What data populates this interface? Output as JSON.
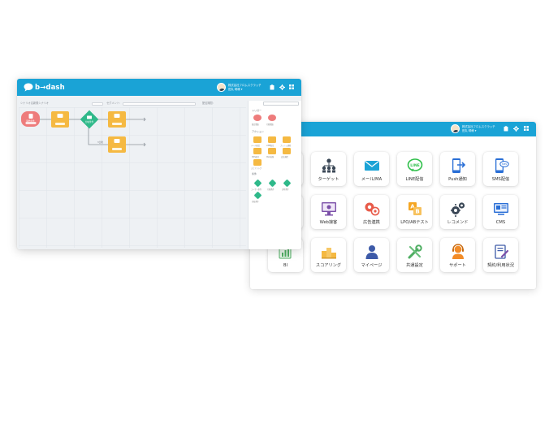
{
  "brand": {
    "logo_text": "b→dash",
    "header_color": "#1aa3d6"
  },
  "back_window": {
    "header": {
      "company": "株式会社フロムスクラッチ",
      "user": "田丸 晴様 ▾",
      "icons": [
        "clipboard-icon",
        "gear-icon",
        "grid-icon"
      ]
    },
    "tiles": [
      {
        "label": "",
        "icon": "partial-tile"
      },
      {
        "label": "ターゲット",
        "icon": "hierarchy-icon"
      },
      {
        "label": "メール/MA",
        "icon": "mail-icon"
      },
      {
        "label": "LINE配信",
        "icon": "line-icon"
      },
      {
        "label": "Push通知",
        "icon": "push-icon"
      },
      {
        "label": "SMS配信",
        "icon": "sms-icon"
      },
      {
        "label": "",
        "icon": "partial-tile"
      },
      {
        "label": "Web接客",
        "icon": "web-icon"
      },
      {
        "label": "広告連携",
        "icon": "ad-icon"
      },
      {
        "label": "LPO/ABテスト",
        "icon": "ab-icon"
      },
      {
        "label": "レコメンド",
        "icon": "recommend-icon"
      },
      {
        "label": "CMS",
        "icon": "cms-icon"
      },
      {
        "label": "BI",
        "icon": "bi-icon"
      },
      {
        "label": "スコアリング",
        "icon": "scoring-icon"
      },
      {
        "label": "マイページ",
        "icon": "mypage-icon"
      },
      {
        "label": "共通設定",
        "icon": "settings-icon"
      },
      {
        "label": "サポート",
        "icon": "support-icon"
      },
      {
        "label": "契約/利用状況",
        "icon": "contract-icon"
      }
    ]
  },
  "front_window": {
    "header": {
      "company": "株式会社フロムスクラッチ",
      "user": "田丸 晴様 ▾",
      "icons": [
        "clipboard-icon",
        "gear-icon",
        "grid-icon"
      ]
    },
    "toolbar": {
      "left_label": "シナリオ名：",
      "left_value": "新規シナリオ",
      "mid_label": "セグメント：",
      "right_label": "配信期間："
    },
    "flow": {
      "start_label": "開始条件",
      "branch_label": "分岐条件",
      "link_label": "3日後"
    },
    "palette": {
      "section_1": "トリガー",
      "section_2": "アクション",
      "section_3": "条件",
      "trigger_labels": [
        "配信開始",
        "行動開始"
      ],
      "action_labels": [
        "メール配信",
        "LINE配信",
        "プッシュ通知",
        "SMS配信",
        "Web接客",
        "広告連携",
        "スコアリング"
      ],
      "condition_labels": [
        "ユーザー条件",
        "行動条件",
        "日時条件",
        "分岐条件"
      ]
    }
  }
}
